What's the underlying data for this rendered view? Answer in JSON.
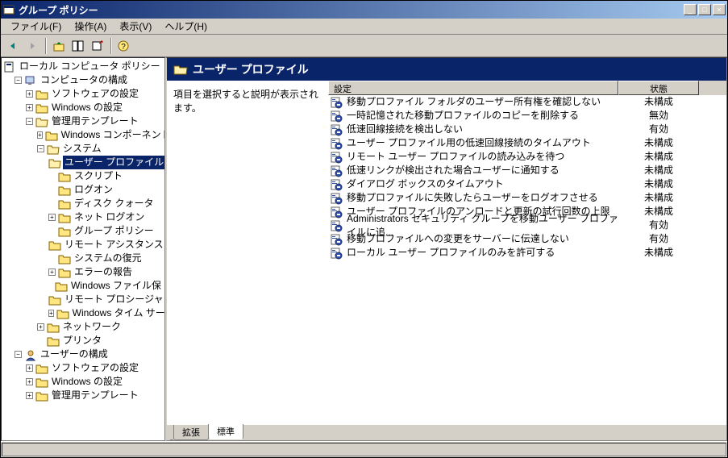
{
  "window": {
    "title": "グループ ポリシー"
  },
  "menu": {
    "file": "ファイル(F)",
    "action": "操作(A)",
    "view": "表示(V)",
    "help": "ヘルプ(H)"
  },
  "tree": {
    "root": "ローカル コンピュータ ポリシー",
    "computer_config": "コンピュータの構成",
    "software_settings": "ソフトウェアの設定",
    "windows_settings": "Windows の設定",
    "admin_templates": "管理用テンプレート",
    "windows_components": "Windows コンポーネント",
    "system": "システム",
    "user_profiles": "ユーザー プロファイル",
    "scripts": "スクリプト",
    "logon": "ログオン",
    "disk_quota": "ディスク クォータ",
    "net_logon": "ネット ログオン",
    "group_policy": "グループ ポリシー",
    "remote_assistance": "リモート アシスタンス",
    "system_restore": "システムの復元",
    "error_reporting": "エラーの報告",
    "windows_file_prot": "Windows ファイル保",
    "remote_procedure": "リモート プロシージャ",
    "windows_time": "Windows タイム サー",
    "network": "ネットワーク",
    "printer": "プリンタ",
    "user_config": "ユーザーの構成",
    "u_software_settings": "ソフトウェアの設定",
    "u_windows_settings": "Windows の設定",
    "u_admin_templates": "管理用テンプレート"
  },
  "header": {
    "title": "ユーザー プロファイル"
  },
  "info_text": "項目を選択すると説明が表示されます。",
  "columns": {
    "setting": "設定",
    "state": "状態"
  },
  "column_widths": {
    "c1": 360,
    "c2": 100
  },
  "settings": [
    {
      "label": "移動プロファイル フォルダのユーザー所有権を確認しない",
      "state": "未構成"
    },
    {
      "label": "一時記憶された移動プロファイルのコピーを削除する",
      "state": "無効"
    },
    {
      "label": "低速回線接続を検出しない",
      "state": "有効"
    },
    {
      "label": "ユーザー プロファイル用の低速回線接続のタイムアウト",
      "state": "未構成"
    },
    {
      "label": "リモート ユーザー プロファイルの読み込みを待つ",
      "state": "未構成"
    },
    {
      "label": "低速リンクが検出された場合ユーザーに通知する",
      "state": "未構成"
    },
    {
      "label": "ダイアログ ボックスのタイムアウト",
      "state": "未構成"
    },
    {
      "label": "移動プロファイルに失敗したらユーザーをログオフさせる",
      "state": "未構成"
    },
    {
      "label": "ユーザー プロファイルのアンロードと更新の試行回数の上限",
      "state": "未構成"
    },
    {
      "label": "Administrators セキュリティ グループを移動ユーザー プロファイルに追...",
      "state": "有効"
    },
    {
      "label": "移動プロファイルへの変更をサーバーに伝達しない",
      "state": "有効"
    },
    {
      "label": "ローカル ユーザー プロファイルのみを許可する",
      "state": "未構成"
    }
  ],
  "tabs": {
    "extended": "拡張",
    "standard": "標準"
  }
}
